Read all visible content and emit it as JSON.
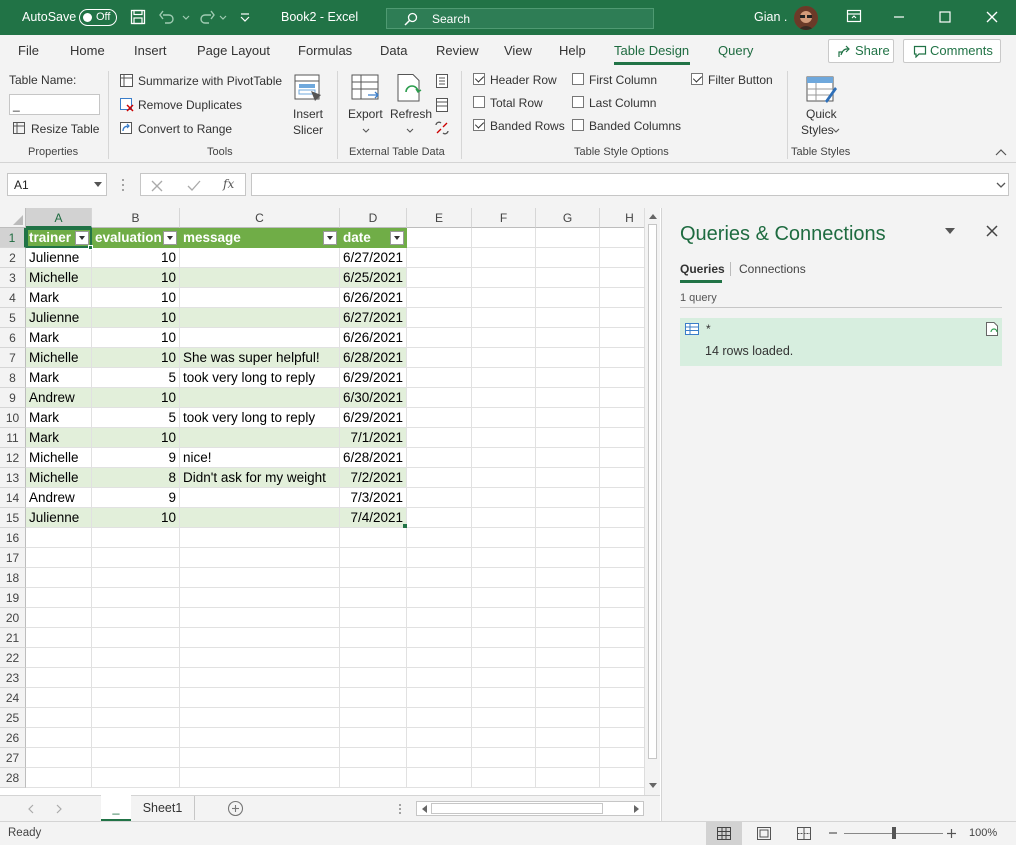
{
  "title_bar": {
    "autosave_label": "AutoSave",
    "autosave_state": "Off",
    "doc_title": "Book2  -  Excel",
    "search_placeholder": "Search",
    "user_name": "Gian ."
  },
  "menu": {
    "tabs": [
      "File",
      "Home",
      "Insert",
      "Page Layout",
      "Formulas",
      "Data",
      "Review",
      "View",
      "Help",
      "Table Design",
      "Query"
    ],
    "active_tab": "Table Design",
    "share_label": "Share",
    "comments_label": "Comments"
  },
  "ribbon": {
    "properties": {
      "table_name_label": "Table Name:",
      "table_name_value": "_",
      "resize_table": "Resize Table",
      "group": "Properties"
    },
    "tools": {
      "summarize": "Summarize with PivotTable",
      "remove_duplicates": "Remove Duplicates",
      "convert": "Convert to Range",
      "insert_slicer": [
        "Insert",
        "Slicer"
      ],
      "group": "Tools"
    },
    "external": {
      "export": "Export",
      "refresh": "Refresh",
      "group": "External Table Data"
    },
    "style_options": {
      "header_row": "Header Row",
      "total_row": "Total Row",
      "banded_rows": "Banded Rows",
      "first_column": "First Column",
      "last_column": "Last Column",
      "banded_columns": "Banded Columns",
      "filter_button": "Filter Button",
      "checked": {
        "header_row": true,
        "total_row": false,
        "banded_rows": true,
        "first_column": false,
        "last_column": false,
        "banded_columns": false,
        "filter_button": true
      },
      "group": "Table Style Options"
    },
    "styles": {
      "quick_styles": [
        "Quick",
        "Styles"
      ],
      "group": "Table Styles"
    }
  },
  "formula_bar": {
    "name_box": "A1",
    "fx": "fx",
    "formula": ""
  },
  "sheet": {
    "columns": [
      "A",
      "B",
      "C",
      "D",
      "E",
      "F",
      "G",
      "H"
    ],
    "selected_column": "A",
    "selected_row": "1",
    "row_numbers": [
      "1",
      "2",
      "3",
      "4",
      "5",
      "6",
      "7",
      "8",
      "9",
      "10",
      "11",
      "12",
      "13",
      "14",
      "15",
      "16",
      "17",
      "18",
      "19",
      "20",
      "21",
      "22",
      "23",
      "24",
      "25",
      "26",
      "27",
      "28"
    ],
    "table_headers": [
      "trainer",
      "evaluation",
      "message",
      "date"
    ],
    "table_rows": [
      [
        "Julienne",
        "10",
        "",
        "6/27/2021"
      ],
      [
        "Michelle",
        "10",
        "",
        "6/25/2021"
      ],
      [
        "Mark",
        "10",
        "",
        "6/26/2021"
      ],
      [
        "Julienne",
        "10",
        "",
        "6/27/2021"
      ],
      [
        "Mark",
        "10",
        "",
        "6/26/2021"
      ],
      [
        "Michelle",
        "10",
        "She was super helpful!",
        "6/28/2021"
      ],
      [
        "Mark",
        "5",
        "took very long to reply",
        "6/29/2021"
      ],
      [
        "Andrew",
        "10",
        "",
        "6/30/2021"
      ],
      [
        "Mark",
        "5",
        "took very long to reply",
        "6/29/2021"
      ],
      [
        "Mark",
        "10",
        "",
        "7/1/2021"
      ],
      [
        "Michelle",
        "9",
        "nice!",
        "6/28/2021"
      ],
      [
        "Michelle",
        "8",
        "Didn't ask for my weight",
        "7/2/2021"
      ],
      [
        "Andrew",
        "9",
        "",
        "7/3/2021"
      ],
      [
        "Julienne",
        "10",
        "",
        "7/4/2021"
      ]
    ]
  },
  "sheet_tabs": {
    "active": "_",
    "tabs": [
      "_",
      "Sheet1"
    ]
  },
  "queries_pane": {
    "title": "Queries & Connections",
    "tab_queries": "Queries",
    "tab_connections": "Connections",
    "count": "1 query",
    "query_name": "*",
    "query_status": "14 rows loaded."
  },
  "status_bar": {
    "status": "Ready",
    "zoom": "100%",
    "zoom_level_fraction": 0.5
  },
  "colors": {
    "excel_green": "#217346",
    "table_header": "#70ad47",
    "band": "#e2efda"
  }
}
